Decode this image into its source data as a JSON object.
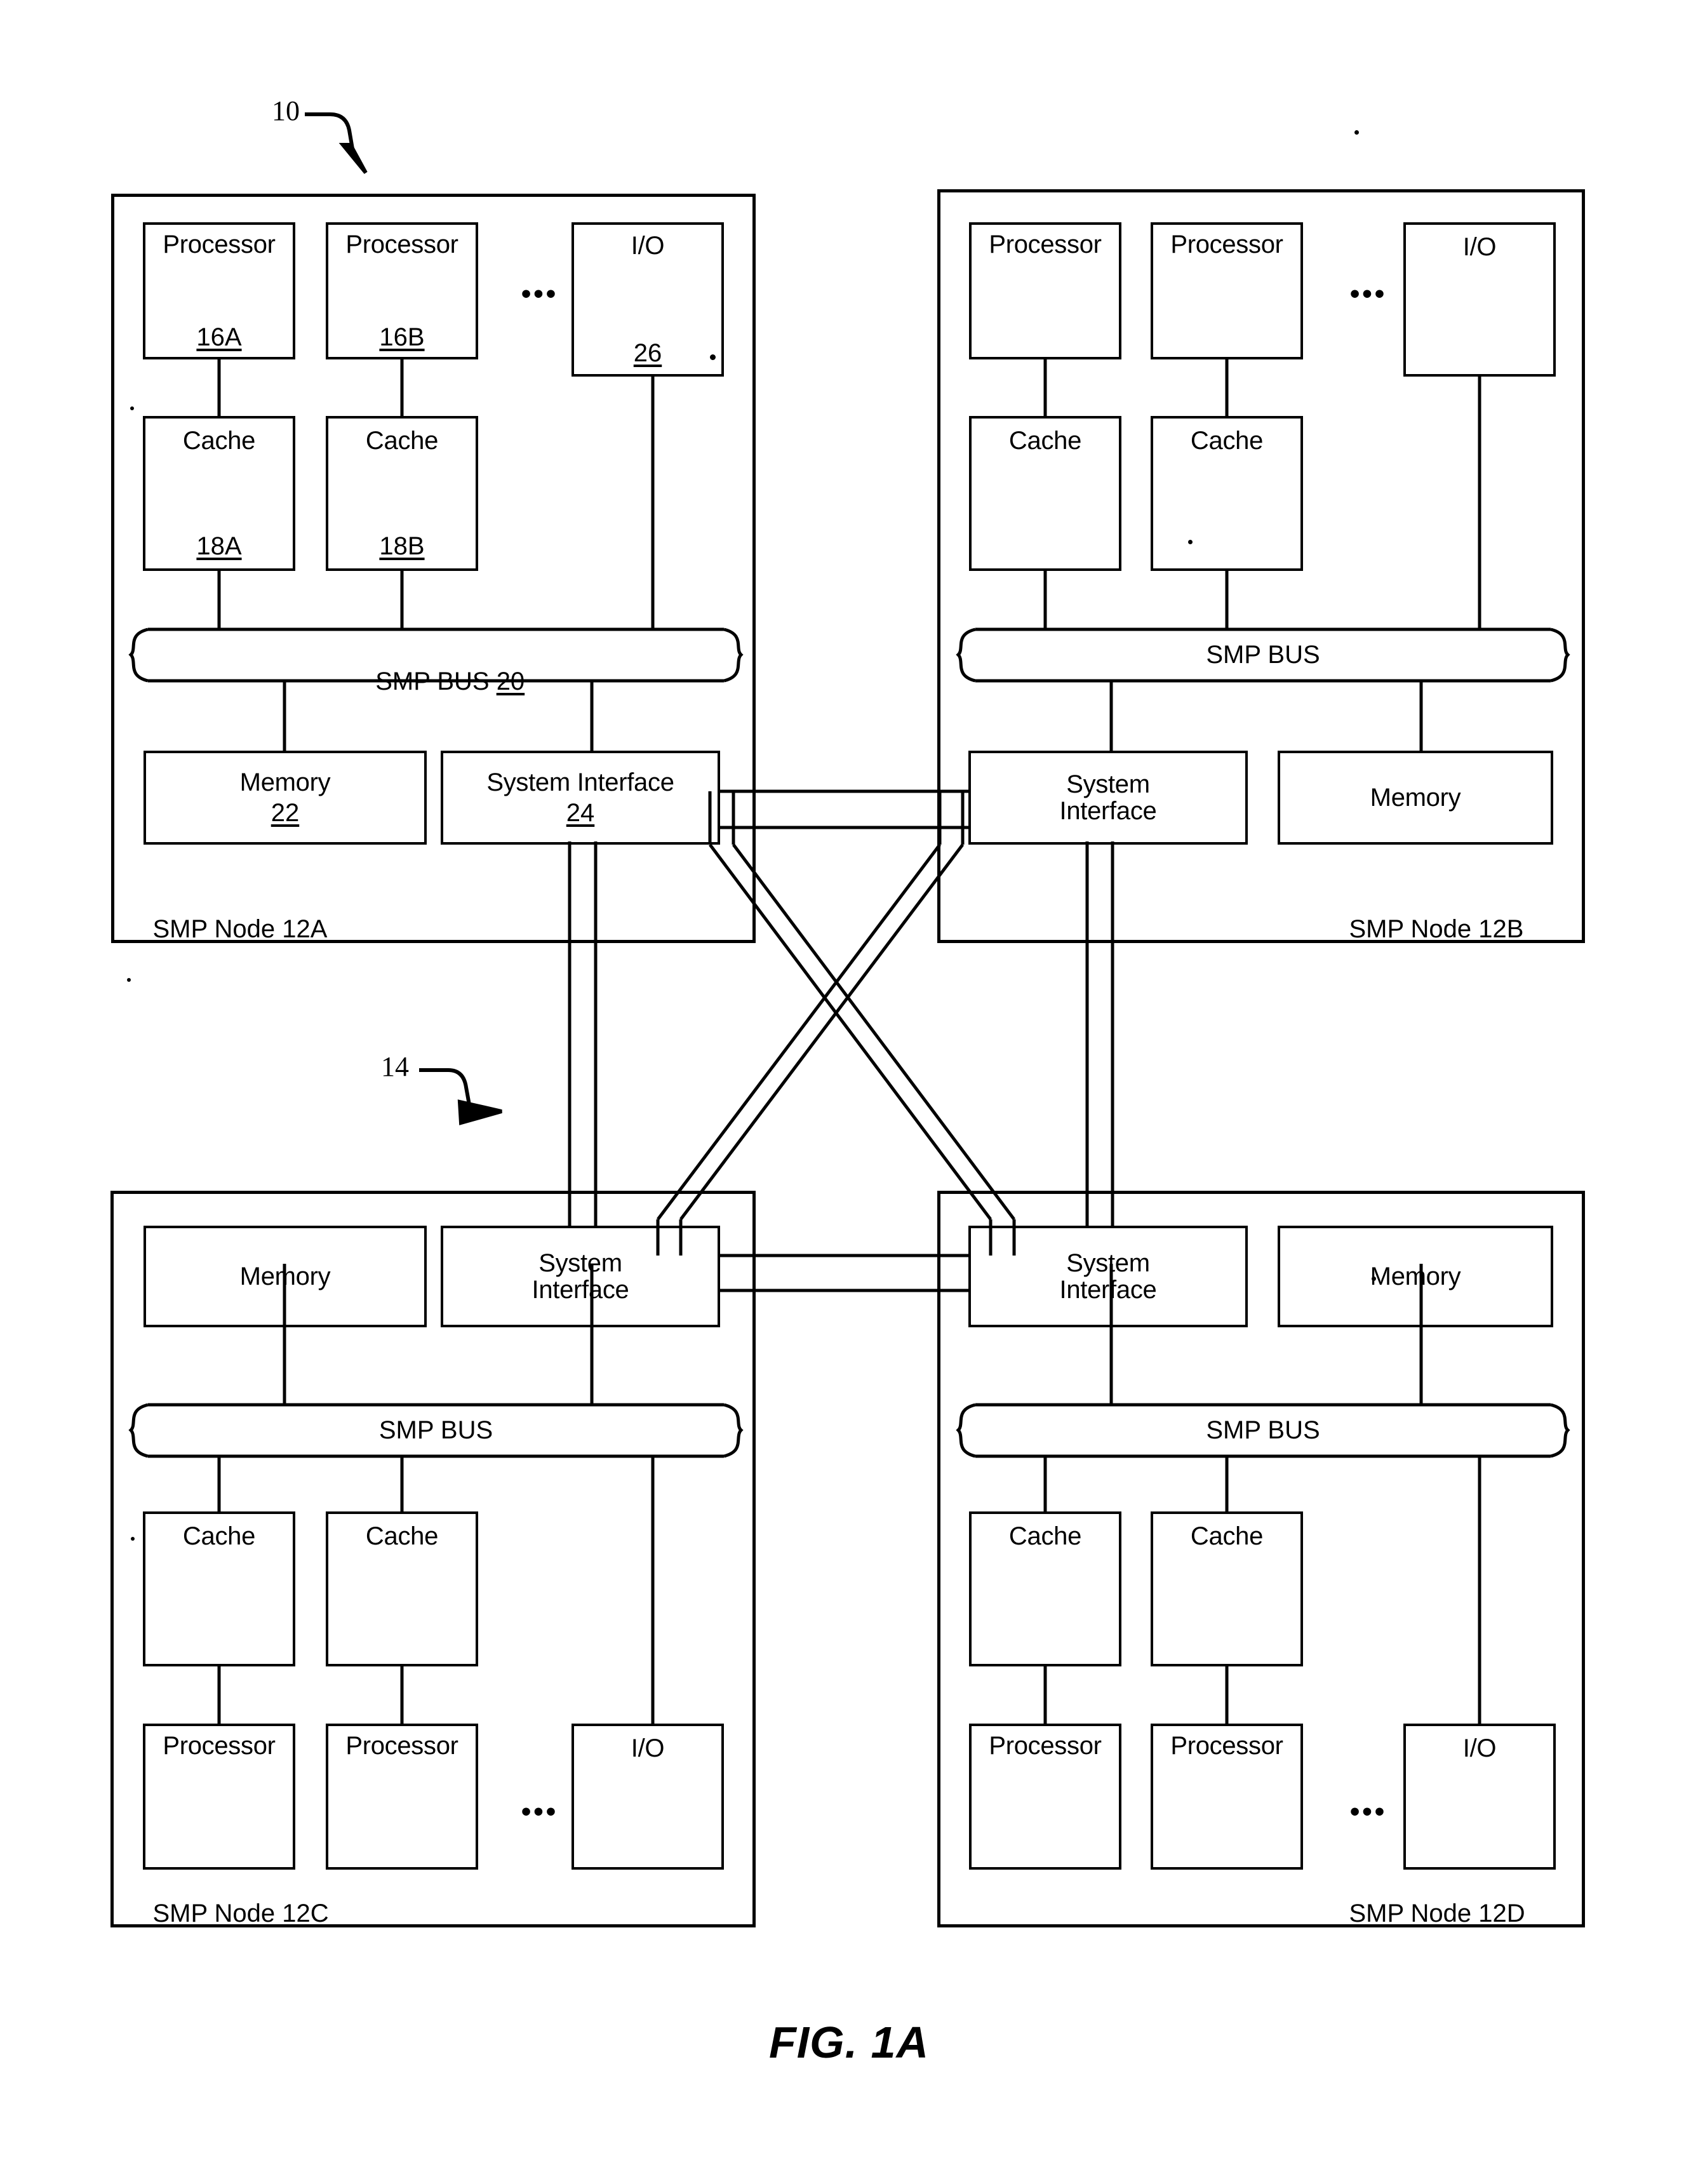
{
  "figure": {
    "caption": "FIG. 1A",
    "system_ref": "10",
    "network_ref": "14"
  },
  "nodes": [
    {
      "id": "12A",
      "label_prefix": "SMP Node ",
      "label_ref": "12A",
      "bus": {
        "label": "SMP BUS ",
        "ref": "20"
      },
      "processors": [
        {
          "label": "Processor",
          "ref": "16A"
        },
        {
          "label": "Processor",
          "ref": "16B"
        }
      ],
      "caches": [
        {
          "label": "Cache",
          "ref": "18A"
        },
        {
          "label": "Cache",
          "ref": "18B"
        }
      ],
      "io": {
        "label": "I/O",
        "ref": "26"
      },
      "memory": {
        "label": "Memory",
        "ref": "22"
      },
      "system_interface": {
        "label": "System Interface",
        "ref": "24"
      },
      "ellipsis": "•••"
    },
    {
      "id": "12B",
      "label_prefix": "SMP Node ",
      "label_ref": "12B",
      "bus": {
        "label": "SMP BUS",
        "ref": ""
      },
      "processors": [
        {
          "label": "Processor",
          "ref": ""
        },
        {
          "label": "Processor",
          "ref": ""
        }
      ],
      "caches": [
        {
          "label": "Cache",
          "ref": ""
        },
        {
          "label": "Cache",
          "ref": ""
        }
      ],
      "io": {
        "label": "I/O",
        "ref": ""
      },
      "memory": {
        "label": "Memory",
        "ref": ""
      },
      "system_interface": {
        "label": "System\nInterface",
        "ref": ""
      },
      "ellipsis": "•••"
    },
    {
      "id": "12C",
      "label_prefix": "SMP Node ",
      "label_ref": "12C",
      "bus": {
        "label": "SMP BUS",
        "ref": ""
      },
      "processors": [
        {
          "label": "Processor",
          "ref": ""
        },
        {
          "label": "Processor",
          "ref": ""
        }
      ],
      "caches": [
        {
          "label": "Cache",
          "ref": ""
        },
        {
          "label": "Cache",
          "ref": ""
        }
      ],
      "io": {
        "label": "I/O",
        "ref": ""
      },
      "memory": {
        "label": "Memory",
        "ref": ""
      },
      "system_interface": {
        "label": "System\nInterface",
        "ref": ""
      },
      "ellipsis": "•••"
    },
    {
      "id": "12D",
      "label_prefix": "SMP Node ",
      "label_ref": "12D",
      "bus": {
        "label": "SMP BUS",
        "ref": ""
      },
      "processors": [
        {
          "label": "Processor",
          "ref": ""
        },
        {
          "label": "Processor",
          "ref": ""
        }
      ],
      "caches": [
        {
          "label": "Cache",
          "ref": ""
        },
        {
          "label": "Cache",
          "ref": ""
        }
      ],
      "io": {
        "label": "I/O",
        "ref": ""
      },
      "memory": {
        "label": "Memory",
        "ref": ""
      },
      "system_interface": {
        "label": "System\nInterface",
        "ref": ""
      },
      "ellipsis": "•••"
    }
  ]
}
